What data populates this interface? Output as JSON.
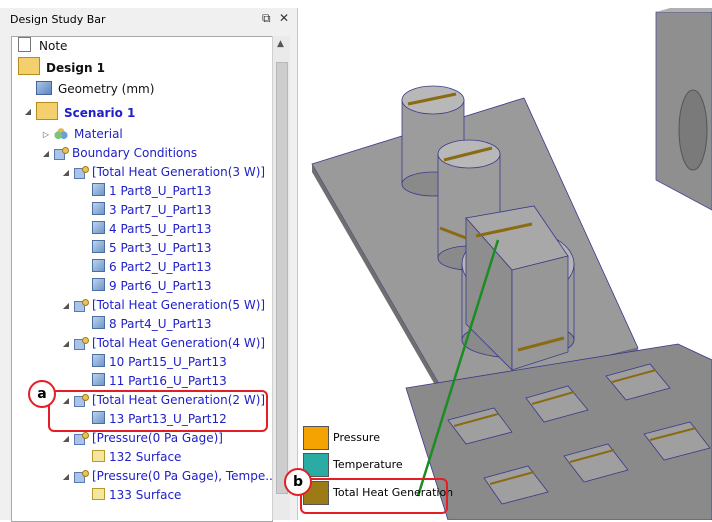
{
  "panel": {
    "title": "Design Study Bar",
    "dock_icon": "pin-icon",
    "close_icon": "close-icon"
  },
  "tree": {
    "note": "Note",
    "design": "Design 1",
    "geometry": "Geometry (mm)",
    "scenario": "Scenario 1",
    "material": "Material",
    "boundary_conditions": "Boundary Conditions",
    "groups": [
      {
        "label": "[Total Heat Generation(3 W)]",
        "parts": [
          "1 Part8_U_Part13",
          "3 Part7_U_Part13",
          "4 Part5_U_Part13",
          "5 Part3_U_Part13",
          "6 Part2_U_Part13",
          "9 Part6_U_Part13"
        ]
      },
      {
        "label": "[Total Heat Generation(5 W)]",
        "parts": [
          "8 Part4_U_Part13"
        ]
      },
      {
        "label": "[Total Heat Generation(4 W)]",
        "parts": [
          "10 Part15_U_Part13",
          "11 Part16_U_Part13"
        ]
      },
      {
        "label": "[Total Heat Generation(2 W)]",
        "parts": [
          "13 Part13_U_Part12"
        ]
      },
      {
        "label": "[Pressure(0 Pa Gage)]",
        "parts": [
          "132 Surface"
        ]
      },
      {
        "label": "[Pressure(0 Pa Gage), Tempe...",
        "parts": [
          "133 Surface"
        ]
      }
    ]
  },
  "callouts": {
    "a": "a",
    "b": "b"
  },
  "legend": [
    {
      "label": "Pressure",
      "color": "#f5a300"
    },
    {
      "label": "Temperature",
      "color": "#2aaba3"
    },
    {
      "label": "Total Heat Generation",
      "color": "#9c7a16"
    }
  ],
  "colors": {
    "highlight": "#e41e26",
    "leader_line": "#1c8c24",
    "tree_link": "#2020c8"
  }
}
